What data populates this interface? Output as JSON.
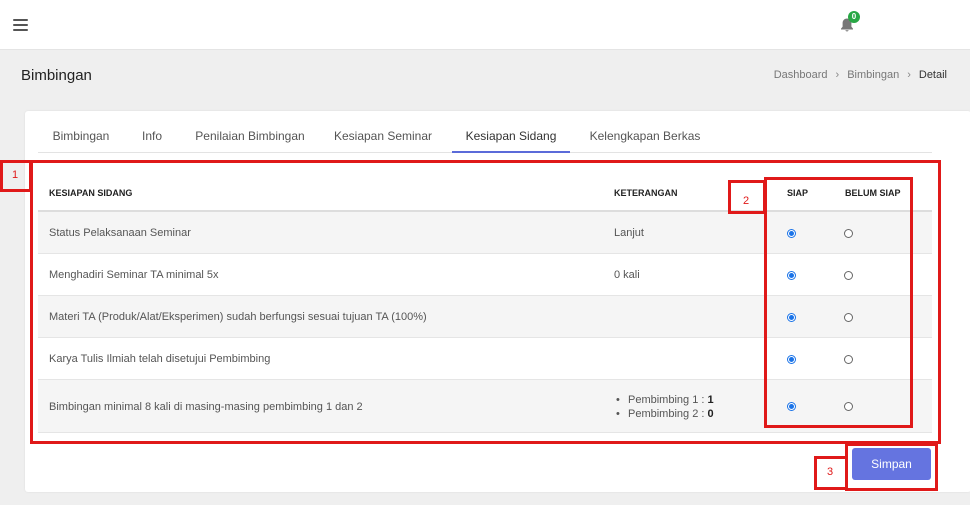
{
  "header": {
    "notification_count": "0"
  },
  "page": {
    "title": "Bimbingan",
    "breadcrumb": [
      "Dashboard",
      "Bimbingan",
      "Detail"
    ]
  },
  "tabs": [
    {
      "label": "Bimbingan"
    },
    {
      "label": "Info"
    },
    {
      "label": "Penilaian Bimbingan"
    },
    {
      "label": "Kesiapan Seminar"
    },
    {
      "label": "Kesiapan Sidang",
      "active": true
    },
    {
      "label": "Kelengkapan Berkas"
    }
  ],
  "table": {
    "columns": [
      "KESIAPAN SIDANG",
      "KETERANGAN",
      "SIAP",
      "BELUM SIAP"
    ],
    "rows": [
      {
        "item": "Status Pelaksanaan Seminar",
        "keterangan": "Lanjut",
        "status": "SIAP"
      },
      {
        "item": "Menghadiri Seminar TA minimal 5x",
        "keterangan": "0 kali",
        "status": "SIAP"
      },
      {
        "item": "Materi TA (Produk/Alat/Eksperimen) sudah berfungsi sesuai tujuan TA (100%)",
        "keterangan": "",
        "status": "SIAP"
      },
      {
        "item": "Karya Tulis Ilmiah telah disetujui Pembimbing",
        "keterangan": "",
        "status": "SIAP"
      },
      {
        "item": "Bimbingan minimal 8 kali di masing-masing pembimbing 1 dan 2",
        "keterangan_list": [
          {
            "label": "Pembimbing 1 : ",
            "value": "1"
          },
          {
            "label": "Pembimbing 2 : ",
            "value": "0"
          }
        ],
        "status": "SIAP"
      }
    ]
  },
  "annotations": [
    "1",
    "2",
    "3"
  ],
  "actions": {
    "save_label": "Simpan"
  },
  "colors": {
    "accent": "#6574e0",
    "annotation": "#e01919",
    "badge": "#28a745",
    "radio": "#1a73e8"
  }
}
